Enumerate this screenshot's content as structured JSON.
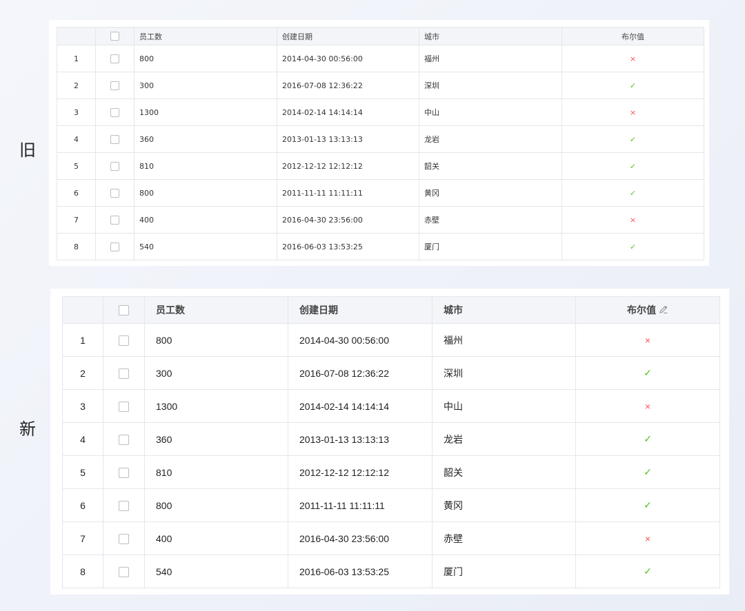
{
  "labels": {
    "old": "旧",
    "new": "新"
  },
  "columns": {
    "employees": "员工数",
    "created": "创建日期",
    "city": "城市",
    "bool": "布尔值"
  },
  "rows": [
    {
      "index": "1",
      "employees": "800",
      "created": "2014-04-30 00:56:00",
      "city": "福州",
      "bool": false,
      "bool_mark": "×"
    },
    {
      "index": "2",
      "employees": "300",
      "created": "2016-07-08 12:36:22",
      "city": "深圳",
      "bool": true,
      "bool_mark": "✓"
    },
    {
      "index": "3",
      "employees": "1300",
      "created": "2014-02-14 14:14:14",
      "city": "中山",
      "bool": false,
      "bool_mark": "×"
    },
    {
      "index": "4",
      "employees": "360",
      "created": "2013-01-13 13:13:13",
      "city": "龙岩",
      "bool": true,
      "bool_mark": "✓"
    },
    {
      "index": "5",
      "employees": "810",
      "created": "2012-12-12 12:12:12",
      "city": "韶关",
      "bool": true,
      "bool_mark": "✓"
    },
    {
      "index": "6",
      "employees": "800",
      "created": "2011-11-11 11:11:11",
      "city": "黄冈",
      "bool": true,
      "bool_mark": "✓"
    },
    {
      "index": "7",
      "employees": "400",
      "created": "2016-04-30 23:56:00",
      "city": "赤壁",
      "bool": false,
      "bool_mark": "×"
    },
    {
      "index": "8",
      "employees": "540",
      "created": "2016-06-03 13:53:25",
      "city": "厦门",
      "bool": true,
      "bool_mark": "✓"
    }
  ],
  "colors": {
    "true": "#52c41a",
    "false": "#ff4d4f",
    "header_bg": "#f3f5f8",
    "border": "#e3e6eb"
  },
  "icons": {
    "header_edit": "pencil-icon",
    "checkbox": "checkbox-icon"
  }
}
